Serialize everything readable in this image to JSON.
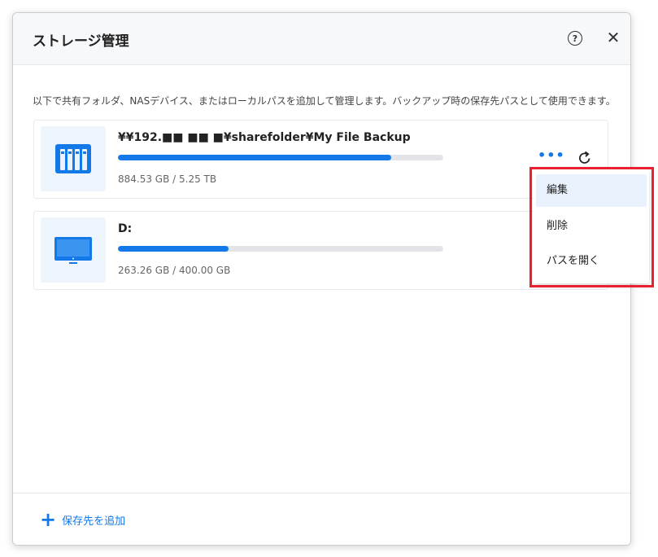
{
  "dialog": {
    "title": "ストレージ管理",
    "help_icon": "question-circle-icon",
    "close_icon": "close-icon",
    "help_glyph": "?",
    "close_glyph": "✕",
    "description": "以下で共有フォルダ、NASデバイス、またはローカルパスを追加して管理します。バックアップ時の保存先パスとして使用できます。"
  },
  "storages": [
    {
      "name": "¥¥192.■■ ■■ ■¥sharefolder¥My File Backup",
      "size": "884.53 GB / 5.25 TB",
      "used_fraction": 0.84,
      "icon": "nas-icon"
    },
    {
      "name": "D:",
      "size": "263.26 GB / 400.00 GB",
      "used_fraction": 0.34,
      "icon": "monitor-icon"
    }
  ],
  "card_actions": {
    "more_glyph": "•••",
    "refresh_icon": "refresh-icon"
  },
  "context_menu": {
    "items": [
      "編集",
      "削除",
      "パスを開く"
    ],
    "active_index": 0
  },
  "footer": {
    "add_label": "保存先を追加",
    "add_glyph": "+"
  },
  "colors": {
    "accent": "#1479e8",
    "highlight": "#e8202f"
  }
}
